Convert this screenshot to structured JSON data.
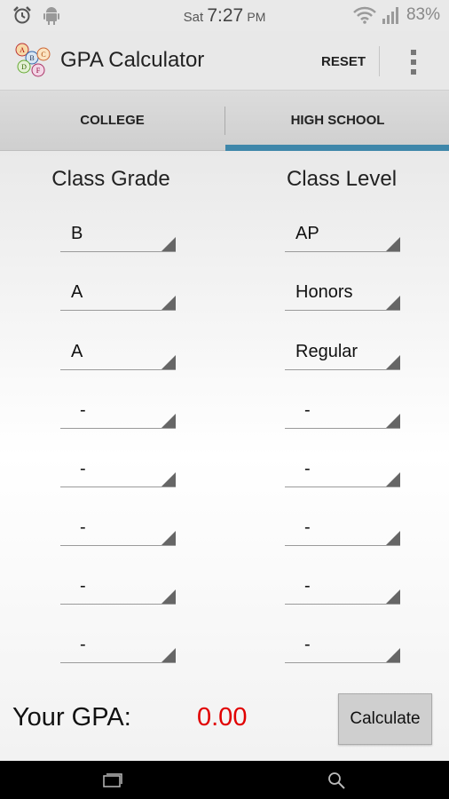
{
  "status_bar": {
    "day": "Sat",
    "time": "7:27",
    "ampm": "PM",
    "battery": "83%",
    "icons": [
      "alarm-icon",
      "android-icon",
      "wifi-icon",
      "signal-icon"
    ]
  },
  "action_bar": {
    "title": "GPA Calculator",
    "reset_label": "RESET",
    "logo_letters": [
      "A",
      "B",
      "C",
      "D",
      "F"
    ]
  },
  "tabs": [
    {
      "label": "COLLEGE",
      "selected": false
    },
    {
      "label": "HIGH SCHOOL",
      "selected": true
    }
  ],
  "columns": {
    "grade_header": "Class Grade",
    "level_header": "Class Level"
  },
  "rows": [
    {
      "grade": "B",
      "level": "AP"
    },
    {
      "grade": "A",
      "level": "Honors"
    },
    {
      "grade": "A",
      "level": "Regular"
    },
    {
      "grade": "-",
      "level": "-"
    },
    {
      "grade": "-",
      "level": "-"
    },
    {
      "grade": "-",
      "level": "-"
    },
    {
      "grade": "-",
      "level": "-"
    },
    {
      "grade": "-",
      "level": "-"
    }
  ],
  "result": {
    "label": "Your GPA:",
    "value": "0.00"
  },
  "calculate_label": "Calculate",
  "colors": {
    "accent": "#3f87aa",
    "gpa_value": "#e10000"
  }
}
